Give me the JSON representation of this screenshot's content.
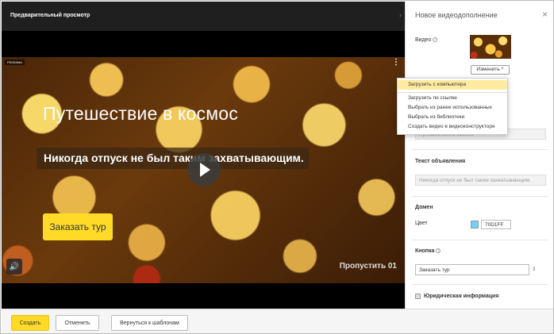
{
  "preview": {
    "title": "Предварительный просмотр",
    "ad_badge": "РЕКЛАМА",
    "headline": "Путешествие в космос",
    "subline": "Никогда отпуск не был таким захватывающим.",
    "cta": "Заказать тур",
    "skip": "Пропустить 01"
  },
  "panel": {
    "title": "Новое видеодополнение",
    "video_label": "Видео",
    "change_button": "Изменить",
    "title_input_placeholder": "Путешествие в космос",
    "ad_text_label": "Текст объявления",
    "ad_text_placeholder": "Никогда отпуск не был таким захватывающим.",
    "domain_label": "Домен",
    "color_label": "Цвет",
    "color_value": "70D1FF",
    "button_label": "Кнопка",
    "button_value": "Заказать тур",
    "button_counter": "3",
    "legal_label": "Юридическая информация"
  },
  "dropdown": {
    "items": [
      "Загрузить с компьютера",
      "Загрузить по ссылке",
      "Выбрать из ранее использованных",
      "Выбрать из библиотеки",
      "Создать видео в видеоконструкторе"
    ]
  },
  "footer": {
    "create": "Создать",
    "cancel": "Отменить",
    "back": "Вернуться к шаблонам"
  },
  "colors": {
    "accent": "#ffdb28",
    "swatch": "#70d1ff"
  }
}
